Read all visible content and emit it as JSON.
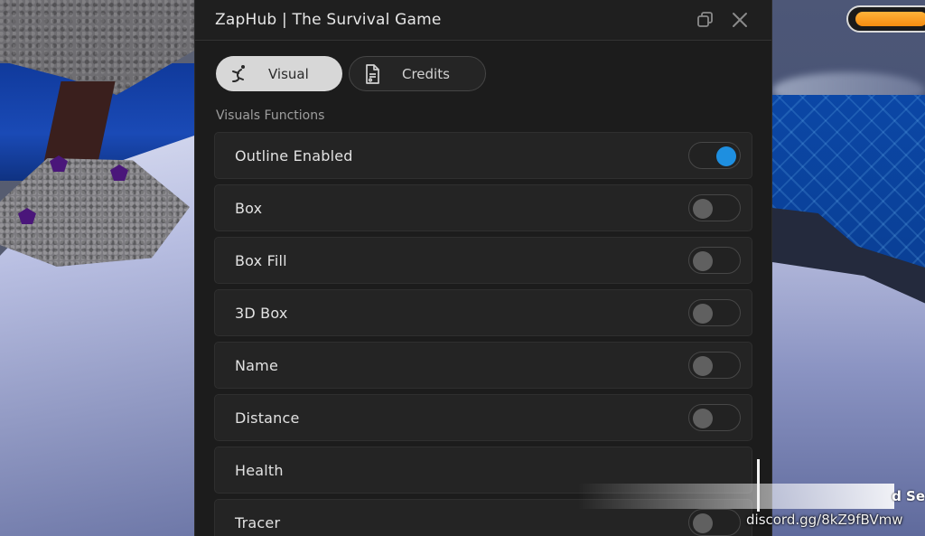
{
  "window": {
    "title": "ZapHub | The Survival Game"
  },
  "tabs": [
    {
      "label": "Visual",
      "icon": "stretch-figure-icon",
      "active": true
    },
    {
      "label": "Credits",
      "icon": "document-icon",
      "active": false
    }
  ],
  "section": {
    "label": "Visuals Functions"
  },
  "rows": [
    {
      "label": "Outline Enabled",
      "enabled": true
    },
    {
      "label": "Box",
      "enabled": false
    },
    {
      "label": "Box Fill",
      "enabled": false
    },
    {
      "label": "3D Box",
      "enabled": false
    },
    {
      "label": "Name",
      "enabled": false
    },
    {
      "label": "Distance",
      "enabled": false
    },
    {
      "label": "Health",
      "enabled": false
    },
    {
      "label": "Tracer",
      "enabled": false
    }
  ],
  "overlay": {
    "discord_text": "discord.gg/8kZ9fBVmw",
    "top_text": "d Se",
    "hud_value": "1"
  },
  "colors": {
    "window_bg": "#1c1c1c",
    "row_bg": "#242424",
    "toggle_on": "#1e8fe0",
    "tab_active_bg": "#d7d7d7"
  }
}
